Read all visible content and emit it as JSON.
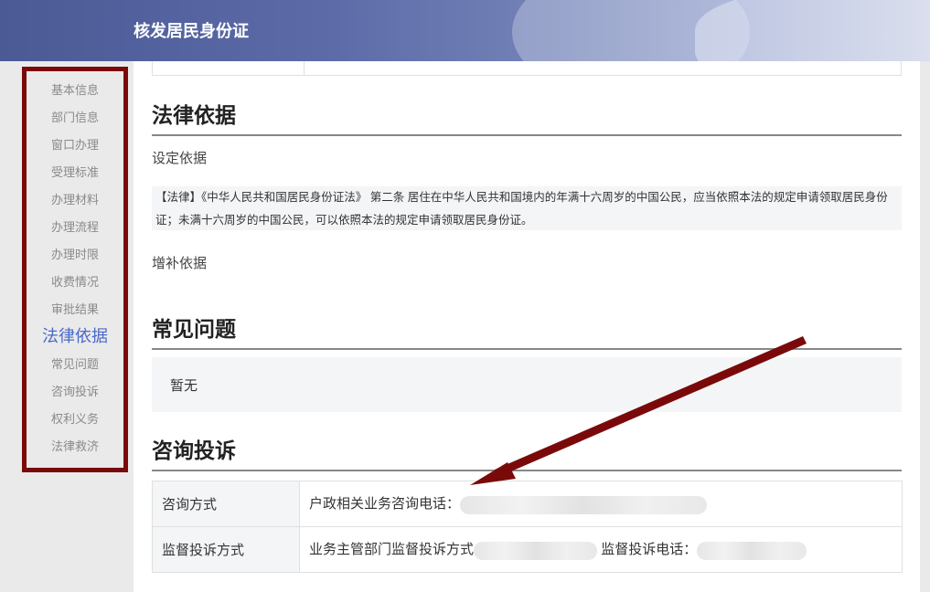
{
  "header": {
    "title": "核发居民身份证"
  },
  "sidebar": {
    "items": [
      {
        "label": "基本信息"
      },
      {
        "label": "部门信息"
      },
      {
        "label": "窗口办理"
      },
      {
        "label": "受理标准"
      },
      {
        "label": "办理材料"
      },
      {
        "label": "办理流程"
      },
      {
        "label": "办理时限"
      },
      {
        "label": "收费情况"
      },
      {
        "label": "审批结果"
      },
      {
        "label": "法律依据",
        "active": true
      },
      {
        "label": "常见问题"
      },
      {
        "label": "咨询投诉"
      },
      {
        "label": "权利义务"
      },
      {
        "label": "法律救济"
      }
    ]
  },
  "legal": {
    "title": "法律依据",
    "set_basis_label": "设定依据",
    "set_basis_text": "【法律】《中华人民共和国居民身份证法》 第二条 居住在中华人民共和国境内的年满十六周岁的中国公民，应当依照本法的规定申请领取居民身份证；未满十六周岁的中国公民，可以依照本法的规定申请领取居民身份证。",
    "supplement_label": "增补依据"
  },
  "faq": {
    "title": "常见问题",
    "content": "暂无"
  },
  "consult": {
    "title": "咨询投诉",
    "rows": [
      {
        "label": "咨询方式",
        "text": "户政相关业务咨询电话："
      },
      {
        "label": "监督投诉方式",
        "text": "业务主管部门监督投诉方式",
        "text2": "监督投诉电话："
      }
    ]
  },
  "colors": {
    "accent": "#4a69c9",
    "highlight_border": "#7a0a0a",
    "arrow": "#7a0a0a"
  }
}
